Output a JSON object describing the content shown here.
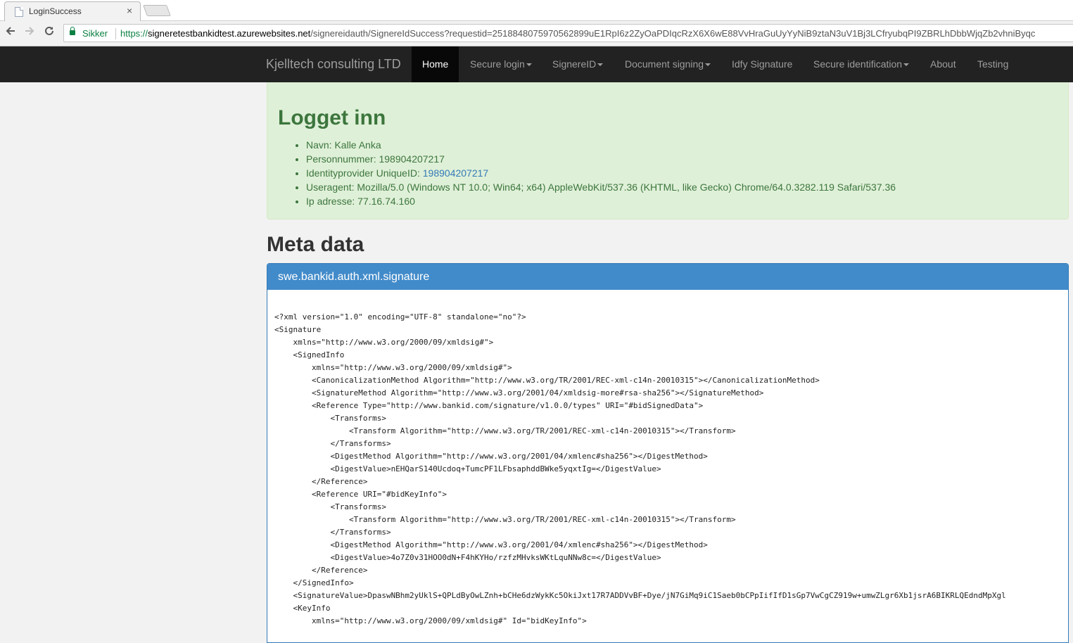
{
  "browser": {
    "tab_title": "LoginSuccess",
    "tab_close": "×",
    "secure_label": "Sikker",
    "url_scheme": "https://",
    "url_host": "signeretestbankidtest.azurewebsites.net",
    "url_path": "/signereidauth/SignereIdSuccess?requestid=25188480759705628​99uE1RpI6z2ZyOaPDIqcRzX6X6wE88VvHraGuUyYyNiB9ztaN3uV1Bj3LCfryubqPI9ZBRLhDbbWjqZb2vhniByqc"
  },
  "navbar": {
    "brand": "Kjelltech consulting LTD",
    "items": [
      {
        "label": "Home",
        "dropdown": false
      },
      {
        "label": "Secure login",
        "dropdown": true
      },
      {
        "label": "SignereID",
        "dropdown": true
      },
      {
        "label": "Document signing",
        "dropdown": true
      },
      {
        "label": "Idfy Signature",
        "dropdown": false
      },
      {
        "label": "Secure identification",
        "dropdown": true
      },
      {
        "label": "About",
        "dropdown": false
      },
      {
        "label": "Testing",
        "dropdown": false
      }
    ]
  },
  "login": {
    "title": "Logget inn",
    "name_label": "Navn: Kalle Anka",
    "ssn_label": "Personnummer: 198904207217",
    "uid_label": "Identityprovider UniqueID: ",
    "uid_value": "198904207217",
    "useragent_label": "Useragent: Mozilla/5.0 (Windows NT 10.0; Win64; x64) AppleWebKit/537.36 (KHTML, like Gecko) Chrome/64.0.3282.119 Safari/537.36",
    "ip_label": "Ip adresse: 77.16.74.160"
  },
  "meta": {
    "heading": "Meta data",
    "panel_title": "swe.bankid.auth.xml.signature",
    "xml_lines": [
      "<?xml version=\"1.0\" encoding=\"UTF-8\" standalone=\"no\"?>",
      "<Signature",
      "    xmlns=\"http://www.w3.org/2000/09/xmldsig#\">",
      "    <SignedInfo",
      "        xmlns=\"http://www.w3.org/2000/09/xmldsig#\">",
      "        <CanonicalizationMethod Algorithm=\"http://www.w3.org/TR/2001/REC-xml-c14n-20010315\"></CanonicalizationMethod>",
      "        <SignatureMethod Algorithm=\"http://www.w3.org/2001/04/xmldsig-more#rsa-sha256\"></SignatureMethod>",
      "        <Reference Type=\"http://www.bankid.com/signature/v1.0.0/types\" URI=\"#bidSignedData\">",
      "            <Transforms>",
      "                <Transform Algorithm=\"http://www.w3.org/TR/2001/REC-xml-c14n-20010315\"></Transform>",
      "            </Transforms>",
      "            <DigestMethod Algorithm=\"http://www.w3.org/2001/04/xmlenc#sha256\"></DigestMethod>",
      "            <DigestValue>nEHQarS140Ucdoq+TumcPF1LFbsaphddBWke5yqxtIg=</DigestValue>",
      "        </Reference>",
      "        <Reference URI=\"#bidKeyInfo\">",
      "            <Transforms>",
      "                <Transform Algorithm=\"http://www.w3.org/TR/2001/REC-xml-c14n-20010315\"></Transform>",
      "            </Transforms>",
      "            <DigestMethod Algorithm=\"http://www.w3.org/2001/04/xmlenc#sha256\"></DigestMethod>",
      "            <DigestValue>4o7Z0v31HOO0dN+F4hKYHo/rzfzMHvksWKtLquNNw8c=</DigestValue>",
      "        </Reference>",
      "    </SignedInfo>",
      "    <SignatureValue>DpaswNBhm2yUklS+QPLdByOwLZnh+bCHe6dzWykKc5OkiJxt17R7ADDVvBF+Dye/jN7GiMq9iC1Saeb0bCPpIifIfD1sGp7VwCgCZ919w+umwZLgr6Xb1jsrA6BIKRLQEdndMpXgl",
      "    <KeyInfo",
      "        xmlns=\"http://www.w3.org/2000/09/xmldsig#\" Id=\"bidKeyInfo\">"
    ]
  }
}
